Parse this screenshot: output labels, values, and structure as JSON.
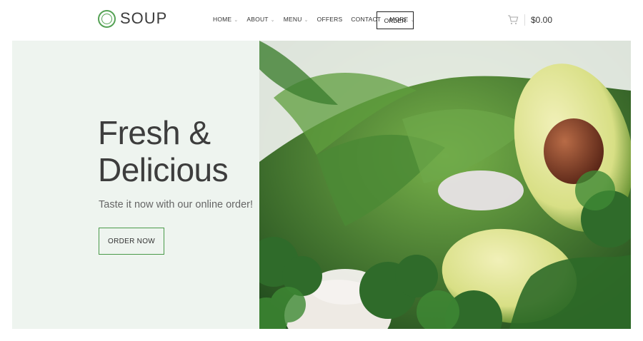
{
  "brand": {
    "name": "SOUP"
  },
  "nav": {
    "items": [
      {
        "label": "HOME",
        "has_dropdown": true
      },
      {
        "label": "ABOUT",
        "has_dropdown": true
      },
      {
        "label": "MENU",
        "has_dropdown": true
      },
      {
        "label": "OFFERS",
        "has_dropdown": false
      },
      {
        "label": "CONTACT",
        "has_dropdown": false
      },
      {
        "label": "MORE",
        "has_dropdown": true
      }
    ],
    "order_label": "ORDER"
  },
  "cart": {
    "total": "$0.00",
    "icon": "cart-icon"
  },
  "hero": {
    "headline_line1": "Fresh &",
    "headline_line2": "Delicious",
    "subtitle": "Taste it now with our online order!",
    "cta_label": "ORDER NOW"
  },
  "colors": {
    "accent": "#55a255",
    "panel": "#eef4ef",
    "text": "#3d3d3d"
  }
}
